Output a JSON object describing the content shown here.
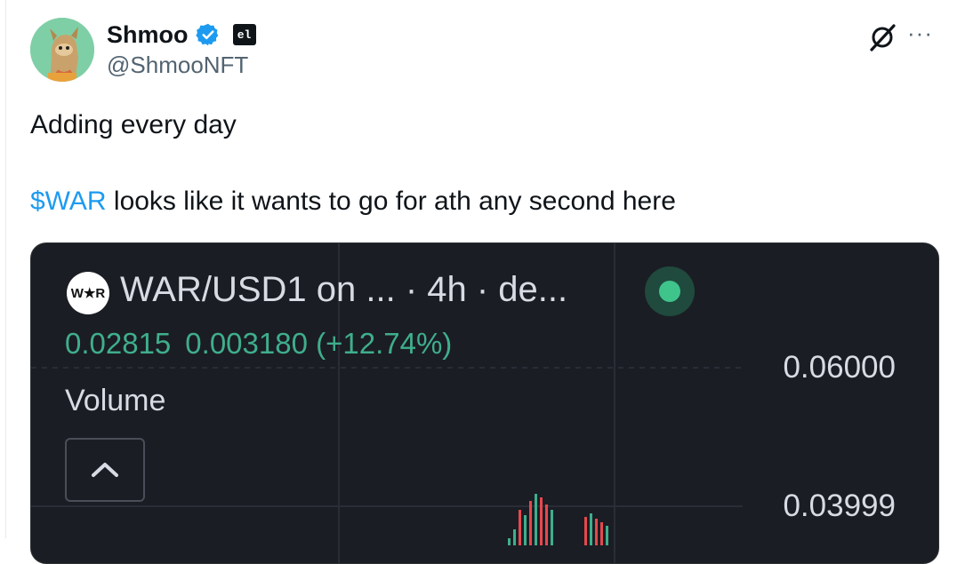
{
  "tweet": {
    "display_name": "Shmoo",
    "handle": "@ShmooNFT",
    "affiliate_badge": "el",
    "text_line1": "Adding every day",
    "cashtag": "$WAR",
    "text_line2_rest": " looks like it wants to go for ath any second here",
    "more_label": "···"
  },
  "media": {
    "pair_logo_text": "W★R",
    "pair_title": "WAR/USD1 on ...  · 4h · de...",
    "price": "0.02815",
    "change": "0.003180 (+12.74%)",
    "volume_label": "Volume",
    "y_ticks": [
      "0.06000",
      "0.03999"
    ],
    "up_color": "#3fae8c",
    "down_color": "#e5484d"
  },
  "icons": {
    "verified": "verified-badge-icon",
    "grok": "grok-icon",
    "more": "more-icon",
    "collapse": "chevron-up-icon"
  }
}
